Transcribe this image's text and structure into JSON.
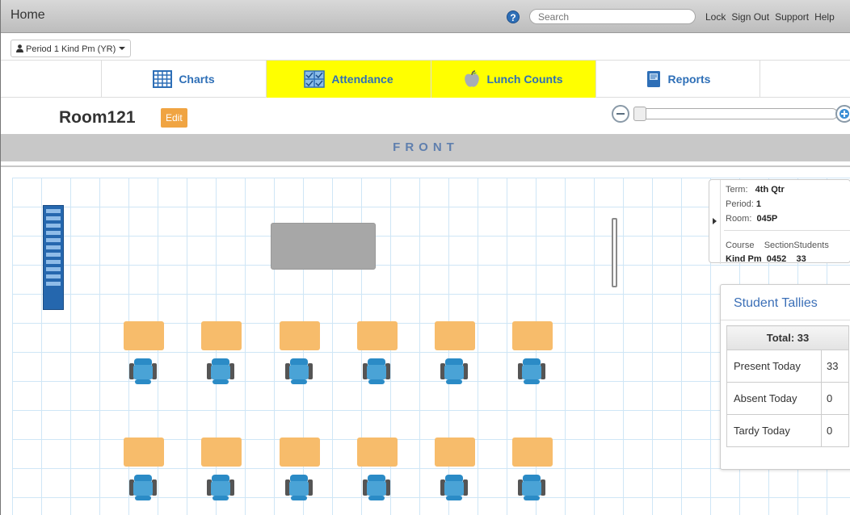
{
  "topbar": {
    "home": "Home",
    "search_placeholder": "Search",
    "links": [
      "Lock",
      "Sign Out",
      "Support",
      "Help"
    ]
  },
  "period_selector": {
    "value": "Period 1 Kind Pm (YR)"
  },
  "tabs": [
    {
      "label": "Charts",
      "icon": "grid-chart-icon",
      "highlighted": false
    },
    {
      "label": "Attendance",
      "icon": "checklist-icon",
      "highlighted": true
    },
    {
      "label": "Lunch Counts",
      "icon": "apple-icon",
      "highlighted": true
    },
    {
      "label": "Reports",
      "icon": "notebook-icon",
      "highlighted": false
    }
  ],
  "room": {
    "title": "Room121",
    "edit_label": "Edit"
  },
  "zoom": {
    "level": 0.0
  },
  "front_label": "FRONT",
  "info_panel": {
    "term_label": "Term:",
    "term_value": "4th Qtr",
    "period_label": "Period:",
    "period_value": "1",
    "room_label": "Room:",
    "room_value": "045P",
    "headers": [
      "Course",
      "Section",
      "Students"
    ],
    "row": [
      "Kind Pm",
      "0452",
      "33"
    ]
  },
  "tallies": {
    "title": "Student Tallies",
    "total": "Total: 33",
    "rows": [
      {
        "label": "Present Today",
        "value": "33"
      },
      {
        "label": "Absent Today",
        "value": "0"
      },
      {
        "label": "Tardy Today",
        "value": "0"
      }
    ]
  },
  "colors": {
    "highlight": "#ffff00",
    "accent_blue": "#2e6fb7",
    "desk": "#f7bc6b",
    "chair": "#4aa3d6",
    "edit_button": "#f0a442",
    "grid_line": "#cfe6f6"
  }
}
